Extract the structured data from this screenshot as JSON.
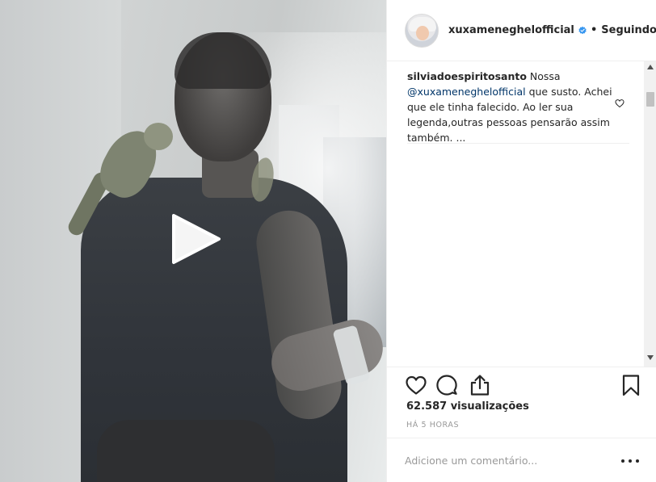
{
  "video": {
    "play_icon": "play-icon"
  },
  "header": {
    "username": "xuxameneghelofficial",
    "verified_icon": "verified-badge-icon",
    "separator": "•",
    "follow_status": "Seguindo"
  },
  "comments": [
    {
      "username": "silviadoespiritosanto",
      "text_before": " Nossa ",
      "mention": "@xuxameneghelofficial",
      "text_after": " que susto. Achei que ele tinha falecido. Ao ler sua legenda,outras pessoas pensarão assim também. ...",
      "like_icon": "heart-outline-icon"
    }
  ],
  "actions": {
    "like_icon": "heart-outline-icon",
    "comment_icon": "comment-bubble-icon",
    "share_icon": "share-icon",
    "save_icon": "bookmark-icon"
  },
  "stats": {
    "views": "62.587 visualizações",
    "time_ago": "HÁ 5 HORAS"
  },
  "add_comment": {
    "placeholder": "Adicione um comentário...",
    "more_icon": "more-options-icon"
  }
}
